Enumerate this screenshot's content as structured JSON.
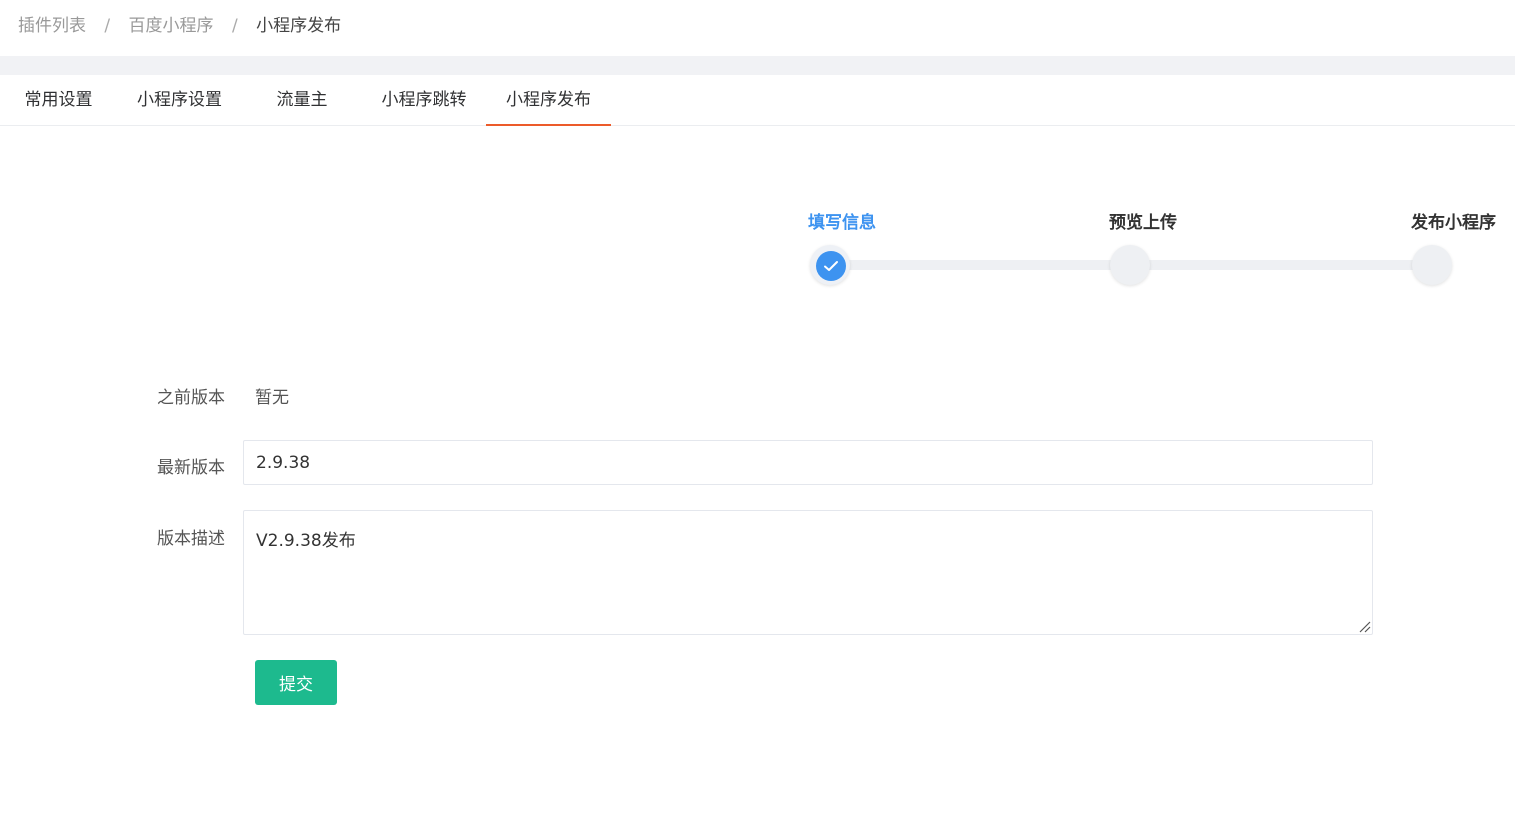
{
  "breadcrumb": {
    "items": [
      "插件列表",
      "百度小程序",
      "小程序发布"
    ],
    "separator": "/"
  },
  "tabs": [
    {
      "label": "常用设置",
      "active": false
    },
    {
      "label": "小程序设置",
      "active": false
    },
    {
      "label": "流量主",
      "active": false
    },
    {
      "label": "小程序跳转",
      "active": false
    },
    {
      "label": "小程序发布",
      "active": true
    }
  ],
  "steps": [
    {
      "title": "填写信息",
      "status": "done",
      "icon": "check-icon"
    },
    {
      "title": "预览上传",
      "status": "pending"
    },
    {
      "title": "发布小程序",
      "status": "pending"
    }
  ],
  "form": {
    "previous_version": {
      "label": "之前版本",
      "value": "暂无"
    },
    "latest_version": {
      "label": "最新版本",
      "value": "2.9.38"
    },
    "description": {
      "label": "版本描述",
      "value": "V2.9.38发布"
    },
    "submit_label": "提交"
  },
  "colors": {
    "accent_tab": "#ec5b2a",
    "step_active": "#3d93f0",
    "submit_button": "#1dba8e"
  }
}
